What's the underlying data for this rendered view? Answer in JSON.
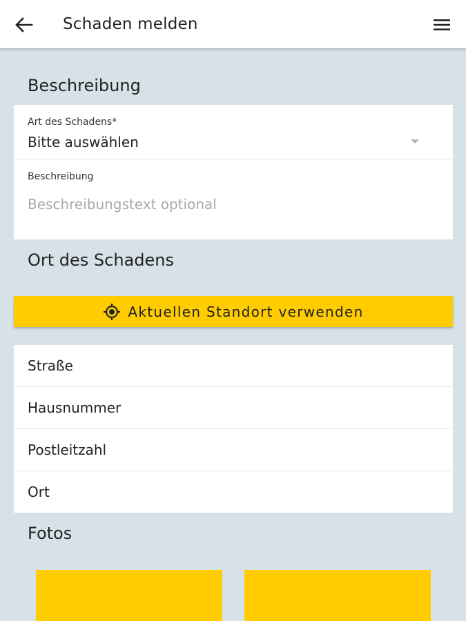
{
  "appbar": {
    "title": "Schaden melden",
    "back_icon": "arrow-left-icon",
    "menu_icon": "hamburger-menu-icon"
  },
  "description_section": {
    "title": "Beschreibung",
    "damage_type": {
      "label": "Art des Schadens*",
      "selected": "Bitte auswählen"
    },
    "description": {
      "label": "Beschreibung",
      "placeholder": "Beschreibungstext optional"
    }
  },
  "location_section": {
    "title": "Ort des Schadens",
    "use_location_button": "Aktuellen Standort verwenden",
    "location_icon": "gps-target-icon",
    "fields": [
      "Straße",
      "Hausnummer",
      "Postleitzahl",
      "Ort"
    ]
  },
  "photos_section": {
    "title": "Fotos"
  },
  "colors": {
    "accent": "#ffcc00",
    "background": "#d7e2e8",
    "surface": "#ffffff"
  }
}
